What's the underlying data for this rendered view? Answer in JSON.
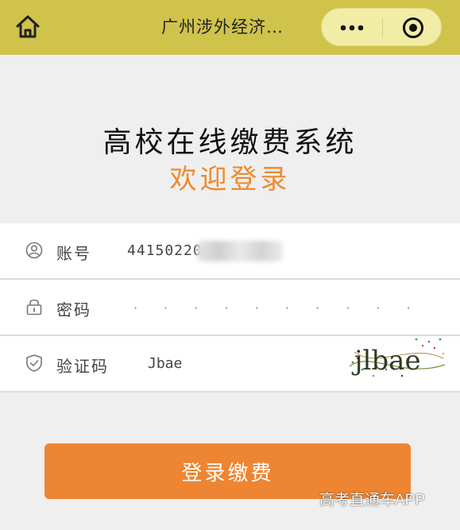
{
  "nav": {
    "title": "广州涉外经济…",
    "bar_color": "#cfc34b"
  },
  "header": {
    "title": "高校在线缴费系统",
    "welcome": "欢迎登录",
    "welcome_color": "#ee8a2e"
  },
  "form": {
    "account": {
      "icon": "user-icon",
      "label": "账号",
      "value": "44150220"
    },
    "password": {
      "icon": "lock-icon",
      "label": "密码",
      "value": "· · · · · · · · · ·"
    },
    "captcha": {
      "icon": "shield-icon",
      "label": "验证码",
      "value": "Jbae",
      "image_text": "jlbae"
    }
  },
  "login_button": {
    "label": "登录缴费",
    "color": "#ed8532"
  },
  "watermark": "高考直通车APP"
}
